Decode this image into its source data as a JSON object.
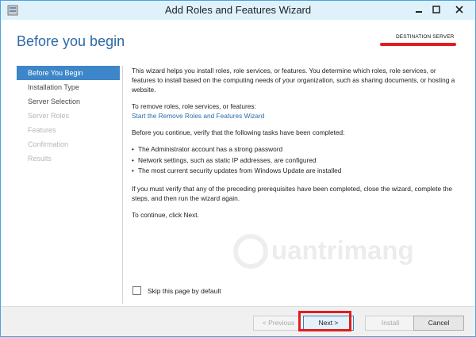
{
  "window": {
    "title": "Add Roles and Features Wizard",
    "controls": {
      "minimize": "minimize-icon",
      "maximize": "maximize-icon",
      "close": "close-icon"
    }
  },
  "header": {
    "page_title": "Before you begin",
    "destination_label": "DESTINATION SERVER"
  },
  "nav": {
    "items": [
      {
        "label": "Before You Begin",
        "state": "active"
      },
      {
        "label": "Installation Type",
        "state": "enabled"
      },
      {
        "label": "Server Selection",
        "state": "enabled"
      },
      {
        "label": "Server Roles",
        "state": "disabled"
      },
      {
        "label": "Features",
        "state": "disabled"
      },
      {
        "label": "Confirmation",
        "state": "disabled"
      },
      {
        "label": "Results",
        "state": "disabled"
      }
    ]
  },
  "content": {
    "intro": "This wizard helps you install roles, role services, or features. You determine which roles, role services, or features to install based on the computing needs of your organization, such as sharing documents, or hosting a website.",
    "remove_label": "To remove roles, role services, or features:",
    "remove_link": "Start the Remove Roles and Features Wizard",
    "verify_intro": "Before you continue, verify that the following tasks have been completed:",
    "bullet": "•",
    "tasks": [
      "The Administrator account has a strong password",
      "Network settings, such as static IP addresses, are configured",
      "The most current security updates from Windows Update are installed"
    ],
    "prereq_note": "If you must verify that any of the preceding prerequisites have been completed, close the wizard, complete the steps, and then run the wizard again.",
    "continue_note": "To continue, click Next."
  },
  "watermark": {
    "text": "uantrimang"
  },
  "skip_checkbox": {
    "label": "Skip this page by default",
    "checked": false
  },
  "footer": {
    "previous": "< Previous",
    "next": "Next >",
    "install": "Install",
    "cancel": "Cancel"
  },
  "colors": {
    "title_blue": "#2d6aa7",
    "nav_active": "#3d86c9",
    "highlight_red": "#e11d20"
  }
}
